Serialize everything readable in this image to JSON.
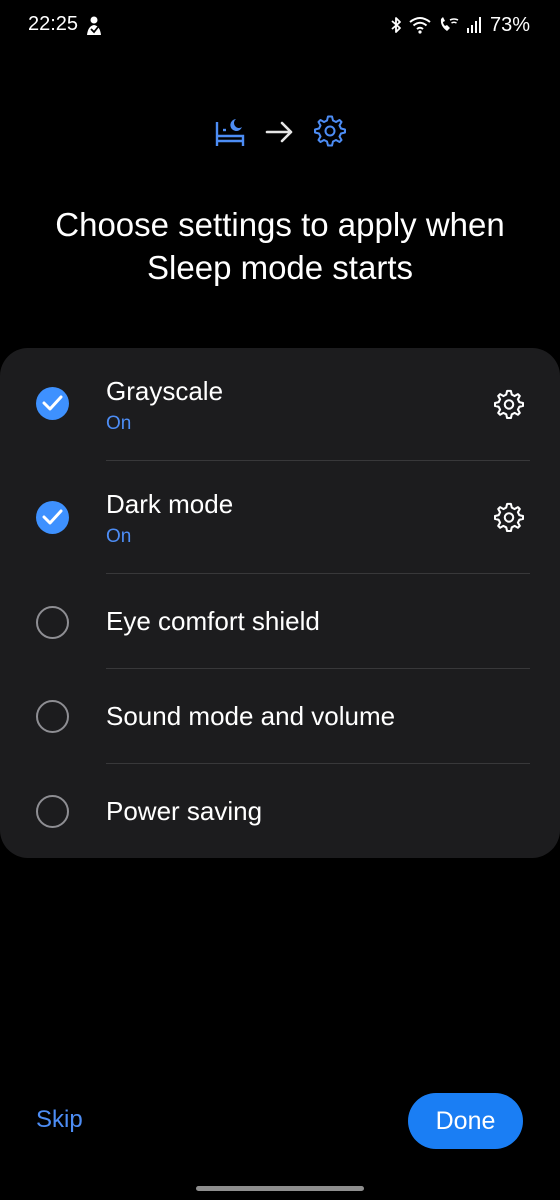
{
  "status_bar": {
    "time": "22:25",
    "battery": "73%",
    "icons": [
      "notification-app-icon",
      "bluetooth-icon",
      "wifi-icon",
      "wifi-calling-icon",
      "signal-icon"
    ]
  },
  "header": {
    "icons": [
      "bed-icon",
      "arrow-right-icon",
      "gear-icon"
    ],
    "title": "Choose settings to apply when Sleep mode starts"
  },
  "settings": {
    "items": [
      {
        "label": "Grayscale",
        "status": "On",
        "checked": true,
        "has_settings": true
      },
      {
        "label": "Dark mode",
        "status": "On",
        "checked": true,
        "has_settings": true
      },
      {
        "label": "Eye comfort shield",
        "checked": false,
        "has_settings": false
      },
      {
        "label": "Sound mode and volume",
        "checked": false,
        "has_settings": false
      },
      {
        "label": "Power saving",
        "checked": false,
        "has_settings": false
      }
    ]
  },
  "footer": {
    "skip_label": "Skip",
    "done_label": "Done"
  },
  "colors": {
    "accent": "#3e91ff",
    "accent_text": "#4d8df5",
    "button": "#1a7ef4",
    "card": "#1c1c1e",
    "background": "#000000"
  }
}
